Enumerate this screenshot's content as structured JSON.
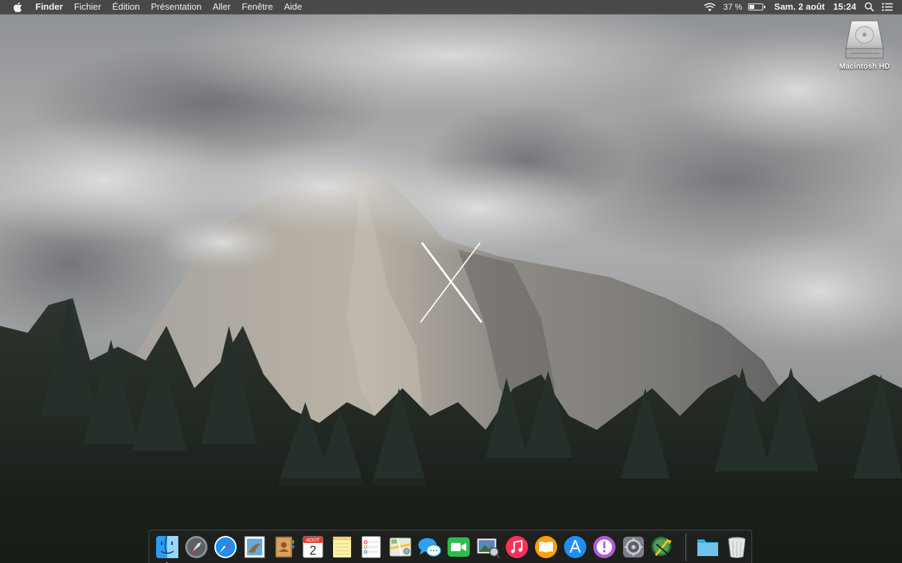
{
  "menubar": {
    "apple_icon": "apple-logo-icon",
    "app_name": "Finder",
    "menus": [
      "Fichier",
      "Édition",
      "Présentation",
      "Aller",
      "Fenêtre",
      "Aide"
    ],
    "battery_percent_label": "37 %",
    "battery_level": 0.37,
    "date_label": "Sam. 2 août",
    "time_label": "15:24",
    "status_icons": [
      "wifi-icon",
      "battery-icon",
      "spotlight-search-icon",
      "notification-center-icon"
    ]
  },
  "desktop": {
    "drive_label": "Macintosh HD",
    "wallpaper": "Yosemite El Capitan with clouds and pine forest",
    "logo": "x-logo"
  },
  "dock": {
    "calendar": {
      "month": "AOÛT",
      "day": "2"
    },
    "apps": [
      "Finder",
      "Launchpad",
      "Safari",
      "Mail",
      "Contacts",
      "Calendar",
      "Notes",
      "Reminders",
      "Maps",
      "Messages",
      "FaceTime",
      "Photo Preview",
      "iTunes",
      "iBooks",
      "App Store",
      "Feedback Assistant",
      "System Preferences",
      "Xcode"
    ],
    "right_items": [
      "Downloads folder",
      "Trash"
    ]
  },
  "colors": {
    "menubar_bg": "#3c3c3e",
    "menubar_text": "#f2f2f2",
    "dock_bg": "#232323"
  }
}
